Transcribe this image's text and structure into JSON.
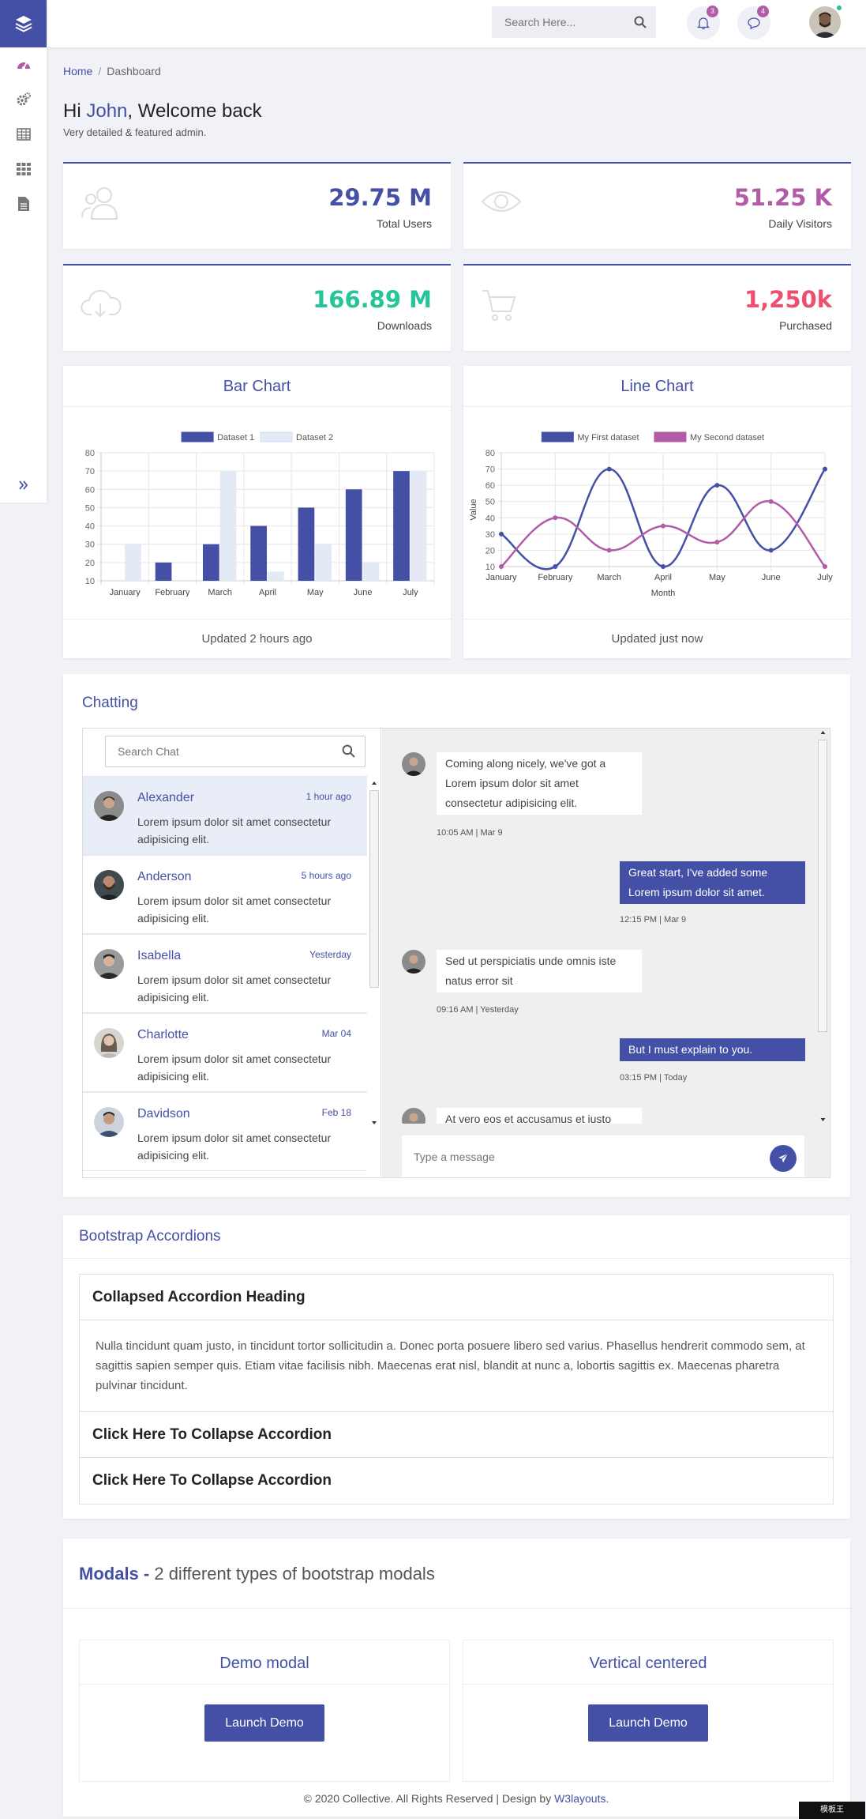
{
  "header": {
    "search_placeholder": "Search Here...",
    "notifications_count": "3",
    "messages_count": "4"
  },
  "breadcrumb": {
    "home": "Home",
    "current": "Dashboard"
  },
  "greeting": {
    "hi": "Hi",
    "name": "John",
    "rest": ", Welcome back",
    "sub": "Very detailed & featured admin."
  },
  "stats": [
    {
      "value": "29.75 M",
      "label": "Total Users",
      "icon": "users-icon",
      "color": "#4450a5"
    },
    {
      "value": "51.25 K",
      "label": "Daily Visitors",
      "icon": "eye-icon",
      "color": "#b25ba6"
    },
    {
      "value": "166.89 M",
      "label": "Downloads",
      "icon": "cloud-download-icon",
      "color": "#25c499"
    },
    {
      "value": "1,250k",
      "label": "Purchased",
      "icon": "cart-icon",
      "color": "#ef4f6e"
    }
  ],
  "bar_card": {
    "title": "Bar Chart",
    "footer": "Updated 2 hours ago"
  },
  "line_card": {
    "title": "Line Chart",
    "footer": "Updated just now"
  },
  "chart_data": [
    {
      "type": "bar",
      "categories": [
        "January",
        "February",
        "March",
        "April",
        "May",
        "June",
        "July"
      ],
      "series": [
        {
          "name": "Dataset 1",
          "values": [
            10,
            20,
            30,
            40,
            50,
            60,
            70
          ],
          "color": "#4450a5"
        },
        {
          "name": "Dataset 2",
          "values": [
            30,
            10,
            70,
            15,
            30,
            20,
            70
          ],
          "color": "#e4eaf5"
        }
      ],
      "ylim": [
        10,
        80
      ],
      "yticks": [
        10,
        20,
        30,
        40,
        50,
        60,
        70,
        80
      ],
      "legend": "top",
      "grid": true
    },
    {
      "type": "line",
      "categories": [
        "January",
        "February",
        "March",
        "April",
        "May",
        "June",
        "July"
      ],
      "series": [
        {
          "name": "My First dataset",
          "values": [
            30,
            10,
            70,
            10,
            60,
            20,
            70
          ],
          "color": "#4450a5"
        },
        {
          "name": "My Second dataset",
          "values": [
            10,
            40,
            20,
            35,
            25,
            50,
            10
          ],
          "color": "#b25ba6"
        }
      ],
      "xlabel": "Month",
      "ylabel": "Value",
      "ylim": [
        10,
        80
      ],
      "yticks": [
        10,
        20,
        30,
        40,
        50,
        60,
        70,
        80
      ],
      "legend": "top",
      "grid": true
    }
  ],
  "chat": {
    "heading": "Chatting",
    "search_placeholder": "Search Chat",
    "contacts": [
      {
        "name": "Alexander",
        "time": "1 hour ago",
        "msg": "Lorem ipsum dolor sit amet consectetur adipisicing elit."
      },
      {
        "name": "Anderson",
        "time": "5 hours ago",
        "msg": "Lorem ipsum dolor sit amet consectetur adipisicing elit."
      },
      {
        "name": "Isabella",
        "time": "Yesterday",
        "msg": "Lorem ipsum dolor sit amet consectetur adipisicing elit."
      },
      {
        "name": "Charlotte",
        "time": "Mar 04",
        "msg": "Lorem ipsum dolor sit amet consectetur adipisicing elit."
      },
      {
        "name": "Davidson",
        "time": "Feb 18",
        "msg": "Lorem ipsum dolor sit amet consectetur adipisicing elit."
      }
    ],
    "messages": [
      {
        "dir": "in",
        "text": "Coming along nicely, we've got a Lorem ipsum dolor sit amet consectetur adipisicing elit.",
        "time": "10:05 AM | Mar 9"
      },
      {
        "dir": "out",
        "text": "Great start, I've added some Lorem ipsum dolor sit amet.",
        "time": "12:15 PM | Mar 9"
      },
      {
        "dir": "in",
        "text": "Sed ut perspiciatis unde omnis iste natus error sit",
        "time": "09:16 AM | Yesterday"
      },
      {
        "dir": "out",
        "text": "But I must explain to you.",
        "time": "03:15 PM | Today"
      },
      {
        "dir": "in",
        "text": "At vero eos et accusamus et iusto",
        "time": ""
      }
    ],
    "composer_placeholder": "Type a message"
  },
  "accordion": {
    "heading": "Bootstrap Accordions",
    "item1": "Collapsed Accordion Heading",
    "body": "Nulla tincidunt quam justo, in tincidunt tortor sollicitudin a. Donec porta posuere libero sed varius. Phasellus hendrerit commodo sem, at sagittis sapien semper quis. Etiam vitae facilisis nibh. Maecenas erat nisl, blandit at nunc a, lobortis sagittis ex. Maecenas pharetra pulvinar tincidunt.",
    "item2": "Click Here To Collapse Accordion",
    "item3": "Click Here To Collapse Accordion"
  },
  "modals": {
    "heading_bold": "Modals -",
    "heading_rest": " 2 different types of bootstrap modals",
    "cards": [
      {
        "title": "Demo modal",
        "button": "Launch Demo"
      },
      {
        "title": "Vertical centered",
        "button": "Launch Demo"
      }
    ]
  },
  "footer": {
    "text": "© 2020 Collective. All Rights Reserved | Design by ",
    "link": "W3layouts",
    "end": "."
  },
  "watermark": "模板王 MOBANWANG.COM"
}
